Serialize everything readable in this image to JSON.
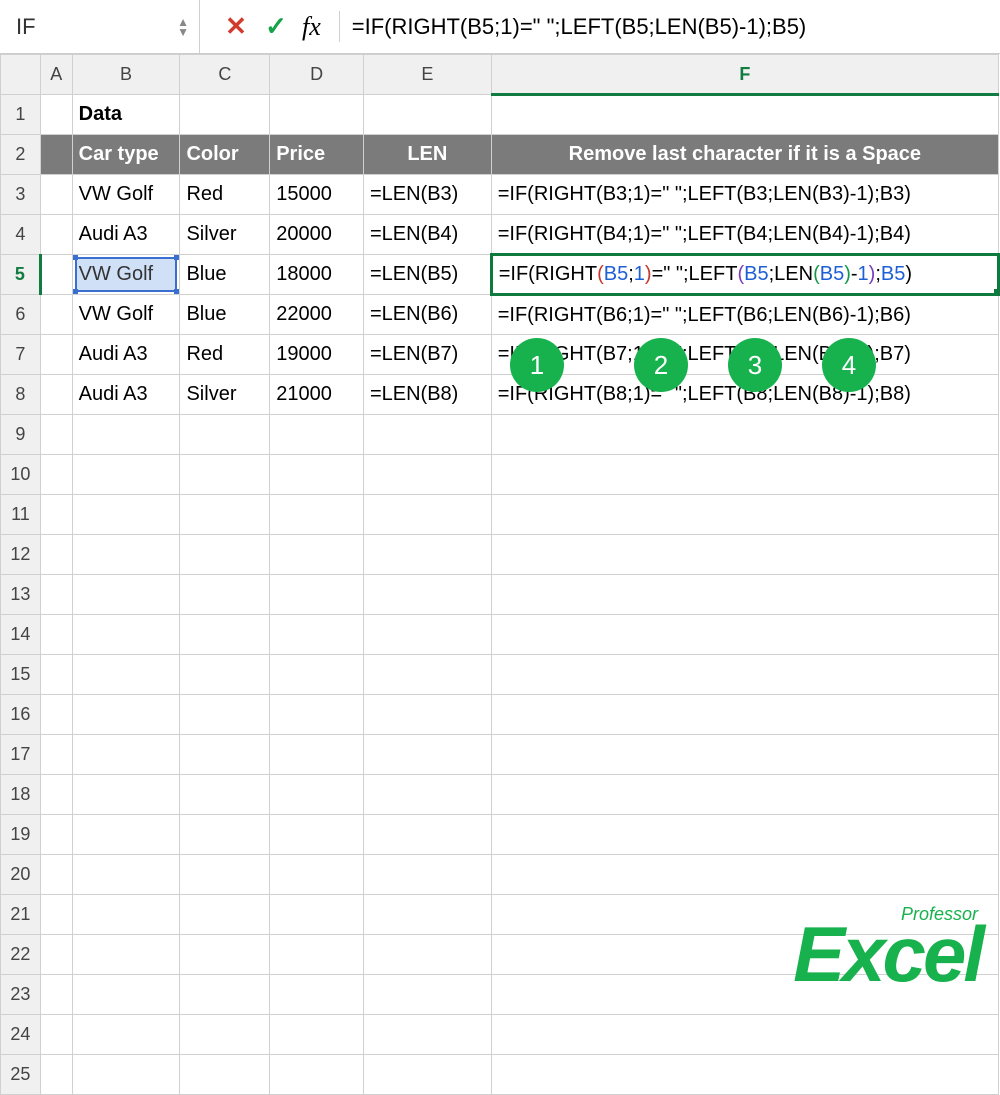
{
  "formula_bar": {
    "name_box": "IF",
    "fx_label": "fx",
    "formula": "=IF(RIGHT(B5;1)=\" \";LEFT(B5;LEN(B5)-1);B5)"
  },
  "columns": {
    "A": "A",
    "B": "B",
    "C": "C",
    "D": "D",
    "E": "E",
    "F": "F"
  },
  "row_count_visible": 25,
  "cells": {
    "B1": "Data",
    "headers": {
      "B2": "Car type",
      "C2": "Color",
      "D2": "Price",
      "E2": "LEN",
      "F2": "Remove last character if it is a Space"
    },
    "rows": [
      {
        "n": 3,
        "car": "VW Golf",
        "color": "Red",
        "price": "15000",
        "len": "=LEN(B3)",
        "form": "=IF(RIGHT(B3;1)=\" \";LEFT(B3;LEN(B3)-1);B3)"
      },
      {
        "n": 4,
        "car": "Audi A3",
        "color": "Silver",
        "price": "20000",
        "len": "=LEN(B4)",
        "form": "=IF(RIGHT(B4;1)=\" \";LEFT(B4;LEN(B4)-1);B4)"
      },
      {
        "n": 5,
        "car": "VW Golf",
        "color": "Blue",
        "price": "18000",
        "len": "=LEN(B5)",
        "form": "=IF(RIGHT(B5;1)=\" \";LEFT(B5;LEN(B5)-1);B5)"
      },
      {
        "n": 6,
        "car": "VW Golf",
        "color": "Blue",
        "price": "22000",
        "len": "=LEN(B6)",
        "form": "=IF(RIGHT(B6;1)=\" \";LEFT(B6;LEN(B6)-1);B6)"
      },
      {
        "n": 7,
        "car": "Audi A3",
        "color": "Red",
        "price": "19000",
        "len": "=LEN(B7)",
        "form": "=IF(RIGHT(B7;1)=\" \";LEFT(B7;LEN(B7)-1);B7)"
      },
      {
        "n": 8,
        "car": "Audi A3",
        "color": "Silver",
        "price": "21000",
        "len": "=LEN(B8)",
        "form": "=IF(RIGHT(B8;1)=\" \";LEFT(B8;LEN(B8)-1);B8)"
      }
    ]
  },
  "edit_formula_tokens": [
    {
      "t": "=IF(RIGHT"
    },
    {
      "t": "(",
      "c": "red"
    },
    {
      "t": "B5",
      "c": "blue"
    },
    {
      "t": ";"
    },
    {
      "t": "1",
      "c": "blue"
    },
    {
      "t": ")",
      "c": "red"
    },
    {
      "t": "=\" \";LEFT"
    },
    {
      "t": "(",
      "c": "purp"
    },
    {
      "t": "B5",
      "c": "blue"
    },
    {
      "t": ";LEN"
    },
    {
      "t": "(",
      "c": "grn"
    },
    {
      "t": "B5",
      "c": "blue"
    },
    {
      "t": ")",
      "c": "grn"
    },
    {
      "t": "-"
    },
    {
      "t": "1",
      "c": "blue"
    },
    {
      "t": ")",
      "c": "purp"
    },
    {
      "t": ";"
    },
    {
      "t": "B5",
      "c": "blue"
    },
    {
      "t": ")"
    }
  ],
  "annotations": {
    "circles": [
      "1",
      "2",
      "3",
      "4"
    ]
  },
  "watermark": {
    "top": "Professor",
    "main": "Excel"
  }
}
